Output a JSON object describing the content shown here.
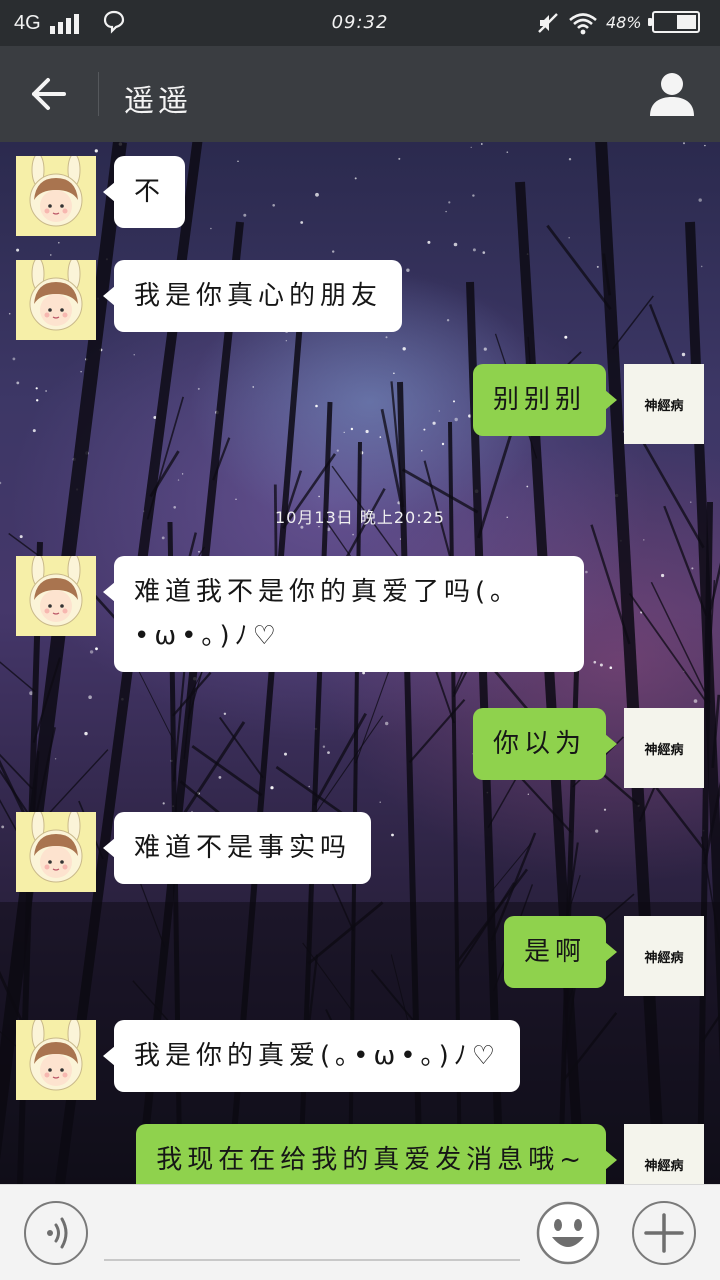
{
  "status_bar": {
    "network": "4G",
    "time": "09:32",
    "battery_text": "48%",
    "battery_level": 0.48
  },
  "header": {
    "title": "遥遥"
  },
  "icons": {
    "back": "arrow-left-icon",
    "profile": "person-icon",
    "voice": "voice-icon",
    "emoji": "smiley-icon",
    "plus": "plus-icon"
  },
  "colors": {
    "sent_bubble": "#8fd24d",
    "received_bubble": "#ffffff",
    "header_bg": "#3a3d41"
  },
  "chat": {
    "my_avatar_label": "神經病",
    "timestamp": "10月13日 晚上20:25",
    "messages": [
      {
        "from": "other",
        "text": "不"
      },
      {
        "from": "other",
        "text": "我是你真心的朋友"
      },
      {
        "from": "me",
        "text": "别别别"
      },
      {
        "from": "other",
        "text": "难道我不是你的真爱了吗(｡•ω•｡)ﾉ♡"
      },
      {
        "from": "me",
        "text": "你以为"
      },
      {
        "from": "other",
        "text": "难道不是事实吗"
      },
      {
        "from": "me",
        "text": "是啊"
      },
      {
        "from": "other",
        "text": "我是你的真爱(｡•ω•｡)ﾉ♡"
      },
      {
        "from": "me",
        "text": "我现在在给我的真爱发消息哦~"
      }
    ]
  },
  "input": {
    "placeholder": ""
  }
}
